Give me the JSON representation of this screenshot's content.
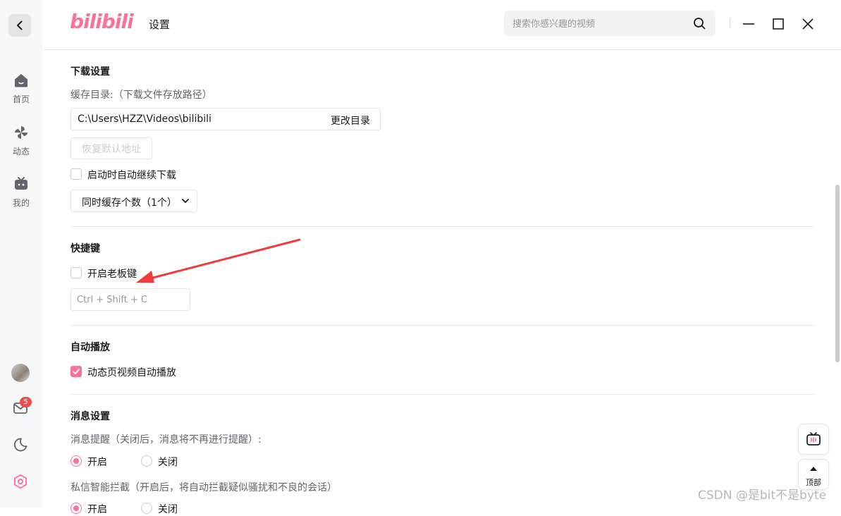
{
  "app": {
    "logo_text": "bilibili",
    "title": "设置",
    "search": {
      "placeholder": "搜索你感兴趣的视频"
    }
  },
  "sidebar": {
    "items": [
      {
        "label": "首页",
        "icon": "home-icon"
      },
      {
        "label": "动态",
        "icon": "pinwheel-icon"
      },
      {
        "label": "我的",
        "icon": "tv-icon"
      }
    ],
    "message_badge": "5"
  },
  "download": {
    "title": "下载设置",
    "cache_dir_label": "缓存目录:（下载文件存放路径）",
    "cache_dir_value": "C:\\Users\\HZZ\\Videos\\bilibili",
    "change_dir_label": "更改目录",
    "restore_default_label": "恢复默认地址",
    "auto_resume_label": "启动时自动继续下载",
    "auto_resume_checked": false,
    "concurrent_select_value": "同时缓存个数（1个）"
  },
  "shortcuts": {
    "title": "快捷键",
    "boss_key_label": "开启老板键",
    "boss_key_checked": false,
    "boss_key_value": "Ctrl + Shift + C"
  },
  "autoplay": {
    "title": "自动播放",
    "feed_autoplay_label": "动态页视频自动播放",
    "feed_autoplay_checked": true
  },
  "messages": {
    "title": "消息设置",
    "reminder_label": "消息提醒（关闭后，消息将不再进行提醒）:",
    "reminder_on": "开启",
    "reminder_off": "关闭",
    "reminder_selected": "开启",
    "filter_label": "私信智能拦截（开启后，将自动拦截疑似骚扰和不良的会话）",
    "filter_on": "开启",
    "filter_off": "关闭",
    "filter_selected": "开启"
  },
  "floating": {
    "top_label": "顶部"
  },
  "watermark": "CSDN @是bit不是byte",
  "colors": {
    "accent": "#fb7299",
    "annotation_arrow": "#f03c3c"
  }
}
